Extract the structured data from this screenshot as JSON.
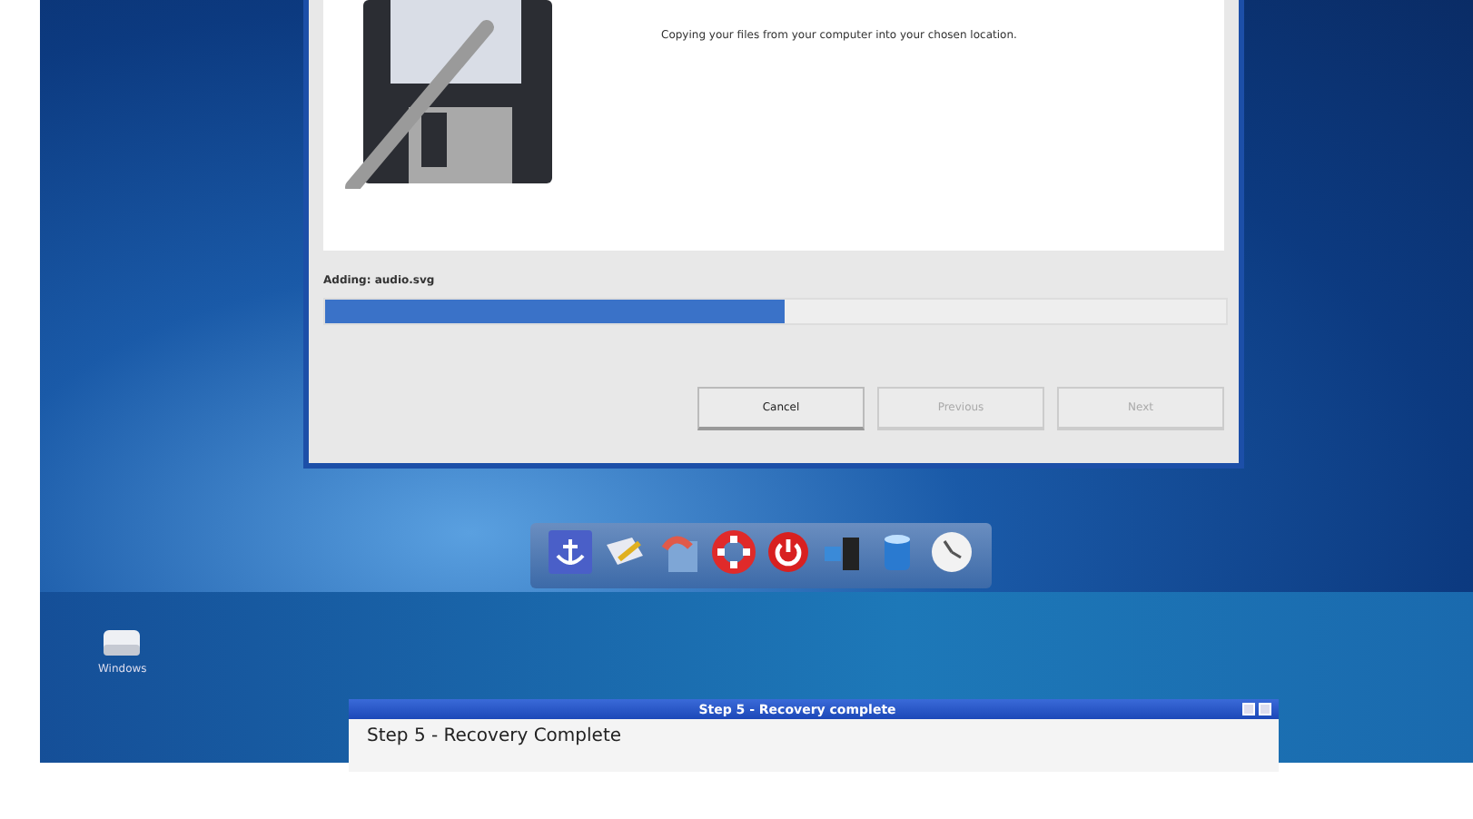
{
  "copying_screen": {
    "dialog": {
      "subtitle": "Copying your files from your computer into your chosen location.",
      "status": "Adding: audio.svg",
      "progress": {
        "level": 0.51
      },
      "buttons": [
        {
          "label": "Cancel",
          "disabled": false
        },
        {
          "label": "Previous",
          "disabled": true
        },
        {
          "label": "Next",
          "disabled": true
        }
      ]
    }
  },
  "recovery_screen": {
    "desktop_icons": [
      {
        "label": "Windows"
      }
    ],
    "window": {
      "title": "Step 5 - Recovery complete",
      "heading": "Step 5 - Recovery Complete"
    }
  }
}
